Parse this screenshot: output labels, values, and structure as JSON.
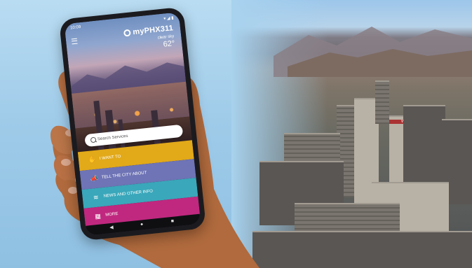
{
  "phone": {
    "status_time": "10:09",
    "status_right": "▾ ◢ ▮",
    "app_name": "myPHX311",
    "weather_label": "clear sky",
    "temperature": "62°"
  },
  "search": {
    "placeholder": "Search Services"
  },
  "tiles": [
    {
      "label": "I WANT TO",
      "icon": "hand-icon",
      "color": "#e2a919"
    },
    {
      "label": "TELL THE CITY ABOUT",
      "icon": "megaphone-icon",
      "color": "#6e74b5"
    },
    {
      "label": "NEWS AND OTHER INFO",
      "icon": "info-icon",
      "color": "#3aa7ba"
    },
    {
      "label": "MORE",
      "icon": "grid-icon",
      "color": "#c0287f"
    }
  ],
  "navbar": {
    "back": "◀",
    "home": "●",
    "recents": "■"
  },
  "scene": {
    "building_sign": "WELLS FARGO"
  }
}
